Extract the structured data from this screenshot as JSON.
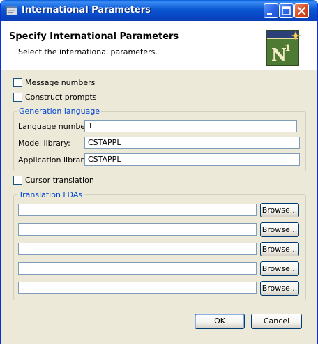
{
  "window": {
    "title": "International Parameters"
  },
  "header": {
    "title": "Specify International Parameters",
    "subtitle": "Select the international parameters.",
    "logo_text": "N",
    "logo_superscript": "1"
  },
  "options": {
    "message_numbers": "Message numbers",
    "construct_prompts": "Construct prompts",
    "cursor_translation": "Cursor translation"
  },
  "generation": {
    "group_label": "Generation language",
    "language_number_label": "Language number:",
    "language_number_value": "1",
    "model_library_label": "Model library:",
    "model_library_value": "CSTAPPL",
    "application_library_label": "Application library:",
    "application_library_value": "CSTAPPL"
  },
  "translation": {
    "group_label": "Translation LDAs",
    "rows": [
      {
        "value": "",
        "browse": "Browse..."
      },
      {
        "value": "",
        "browse": "Browse..."
      },
      {
        "value": "",
        "browse": "Browse..."
      },
      {
        "value": "",
        "browse": "Browse..."
      },
      {
        "value": "",
        "browse": "Browse..."
      }
    ]
  },
  "buttons": {
    "ok": "OK",
    "cancel": "Cancel"
  },
  "colors": {
    "titlebar": "#0b57d2",
    "dialog_bg": "#ece9d8",
    "group_label": "#0046d5",
    "close_button": "#d54a22"
  },
  "icons": {
    "window": "app-window-icon",
    "minimize": "minimize-icon",
    "maximize": "maximize-icon",
    "close": "close-icon",
    "logo": "natural-n1-logo"
  }
}
